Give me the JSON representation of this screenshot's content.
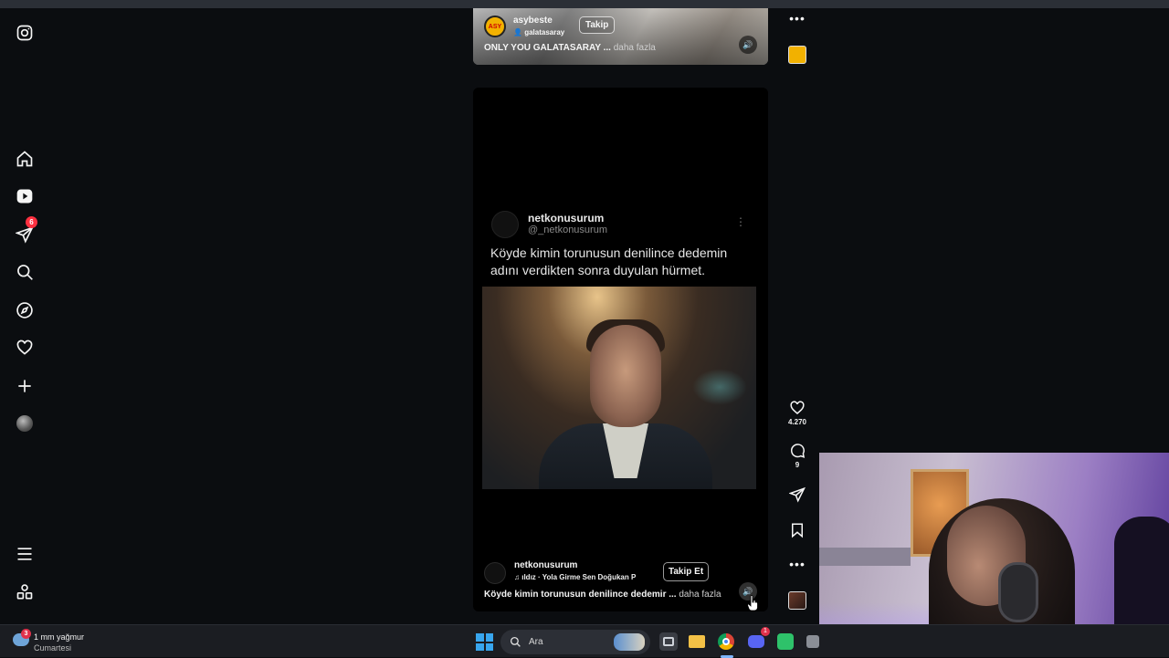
{
  "sidebar": {
    "items": [
      {
        "name": "instagram-logo-icon"
      },
      {
        "name": "home-icon"
      },
      {
        "name": "reels-icon"
      },
      {
        "name": "messages-icon",
        "badge": "6"
      },
      {
        "name": "search-icon"
      },
      {
        "name": "explore-icon"
      },
      {
        "name": "notifications-heart-icon"
      },
      {
        "name": "create-plus-icon"
      },
      {
        "name": "profile-avatar"
      },
      {
        "name": "more-menu-icon"
      },
      {
        "name": "also-from-meta-icon"
      }
    ]
  },
  "reel_top": {
    "username": "asybeste",
    "subtitle": "galatasaray",
    "follow_label": "Takip",
    "caption": "ONLY YOU GALATASARAY ...",
    "more_label": "daha fazla",
    "avatar_text": "ASY"
  },
  "reel_main": {
    "tweet": {
      "name": "netkonusurum",
      "handle": "@_netkonusurum",
      "text": "Köyde kimin torunusun denilince dedemin adını verdikten sonra duyulan hürmet."
    },
    "username": "netkonusurum",
    "music": "ıldız · Yola Girme Sen   Doğukan P",
    "follow_label": "Takip Et",
    "caption": "Köyde kimin torunusun denilince dedemir ...",
    "more_label": "daha fazla"
  },
  "actions": {
    "likes": "4.270",
    "comments": "9"
  },
  "taskbar": {
    "weather_line1": "1 mm yağmur",
    "weather_line2": "Cumartesi",
    "weather_badge": "3",
    "search_placeholder": "Ara",
    "discord_badge": "1"
  },
  "colors": {
    "background": "#0b0d10",
    "badge_red": "#ff3040",
    "windows_blue": "#38a6ee"
  }
}
